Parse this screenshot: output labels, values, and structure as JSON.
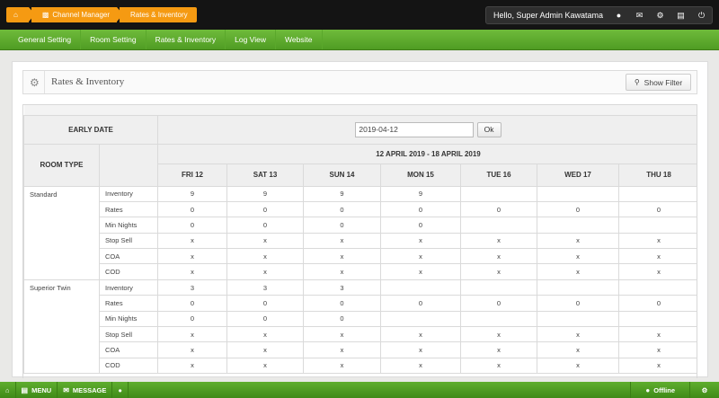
{
  "breadcrumbs": [
    "",
    "Channel Manager",
    "Rates & Inventory"
  ],
  "user": {
    "greeting": "Hello, Super Admin Kawatama"
  },
  "icons": {
    "home": "home-icon",
    "chart": "bar-chart-icon",
    "user": "user-icon",
    "mail": "envelope-icon",
    "gear": "gear-icon",
    "briefcase": "briefcase-icon",
    "power": "power-icon",
    "search": "search-icon"
  },
  "nav": [
    "General Setting",
    "Room Setting",
    "Rates & Inventory",
    "Log View",
    "Website"
  ],
  "panel": {
    "title": "Rates & Inventory",
    "show_filter": "Show Filter"
  },
  "grid": {
    "early_date_label": "EARLY DATE",
    "early_date_value": "2019-04-12",
    "ok_label": "Ok",
    "room_type_label": "ROOM TYPE",
    "range_label": "12 APRIL 2019 - 18 APRIL 2019",
    "days": [
      "FRI 12",
      "SAT 13",
      "SUN 14",
      "MON 15",
      "TUE 16",
      "WED 17",
      "THU 18"
    ],
    "rooms": [
      {
        "name": "Standard",
        "rows": [
          {
            "label": "Inventory",
            "values": [
              "9",
              "9",
              "9",
              "9",
              "",
              "",
              ""
            ]
          },
          {
            "label": "Rates",
            "values": [
              "0",
              "0",
              "0",
              "0",
              "0",
              "0",
              "0"
            ]
          },
          {
            "label": "Min Nights",
            "values": [
              "0",
              "0",
              "0",
              "0",
              "",
              "",
              ""
            ]
          },
          {
            "label": "Stop Sell",
            "values": [
              "x",
              "x",
              "x",
              "x",
              "x",
              "x",
              "x"
            ]
          },
          {
            "label": "COA",
            "values": [
              "x",
              "x",
              "x",
              "x",
              "x",
              "x",
              "x"
            ]
          },
          {
            "label": "COD",
            "values": [
              "x",
              "x",
              "x",
              "x",
              "x",
              "x",
              "x"
            ]
          }
        ]
      },
      {
        "name": "Superior Twin",
        "rows": [
          {
            "label": "Inventory",
            "values": [
              "3",
              "3",
              "3",
              "",
              "",
              "",
              ""
            ]
          },
          {
            "label": "Rates",
            "values": [
              "0",
              "0",
              "0",
              "0",
              "0",
              "0",
              "0"
            ]
          },
          {
            "label": "Min Nights",
            "values": [
              "0",
              "0",
              "0",
              "",
              "",
              "",
              ""
            ]
          },
          {
            "label": "Stop Sell",
            "values": [
              "x",
              "x",
              "x",
              "x",
              "x",
              "x",
              "x"
            ]
          },
          {
            "label": "COA",
            "values": [
              "x",
              "x",
              "x",
              "x",
              "x",
              "x",
              "x"
            ]
          },
          {
            "label": "COD",
            "values": [
              "x",
              "x",
              "x",
              "x",
              "x",
              "x",
              "x"
            ]
          }
        ]
      }
    ]
  },
  "bottombar": {
    "menu": "MENU",
    "message": "MESSAGE",
    "status": "Offline"
  }
}
